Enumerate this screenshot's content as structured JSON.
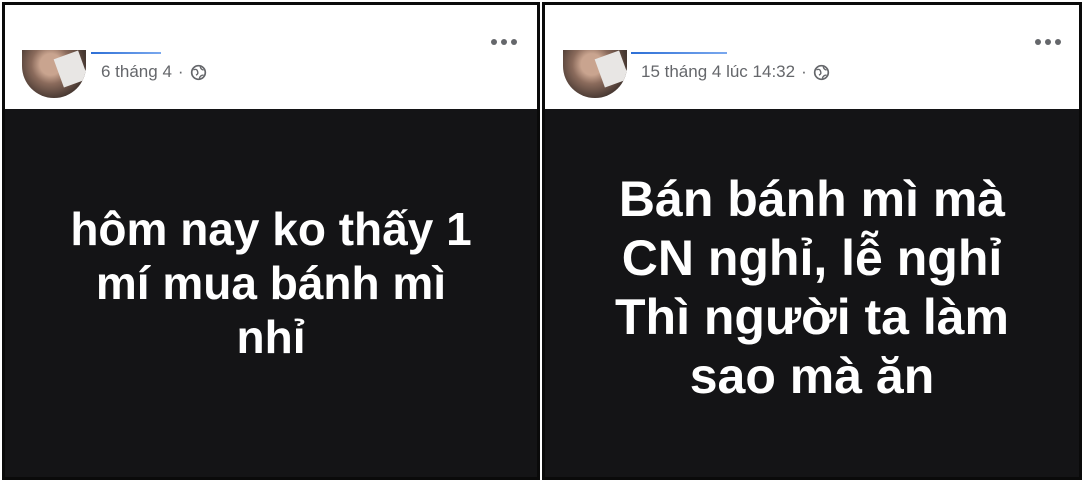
{
  "posts": [
    {
      "timestamp": "6 tháng 4",
      "separator": "·",
      "privacy_icon": "globe-icon",
      "more_icon": "more-options-icon",
      "text": "hôm nay ko thấy 1\nmí mua bánh mì\nnhỉ"
    },
    {
      "timestamp": "15 tháng 4 lúc 14:32",
      "separator": "·",
      "privacy_icon": "globe-icon",
      "more_icon": "more-options-icon",
      "text": "Bán bánh mì mà\nCN nghỉ, lễ nghỉ\nThì người ta làm\nsao mà ăn"
    }
  ],
  "colors": {
    "post_background": "#141416",
    "post_text": "#ffffff",
    "meta_text": "#65676b",
    "frame_border": "#0a0a0a"
  }
}
